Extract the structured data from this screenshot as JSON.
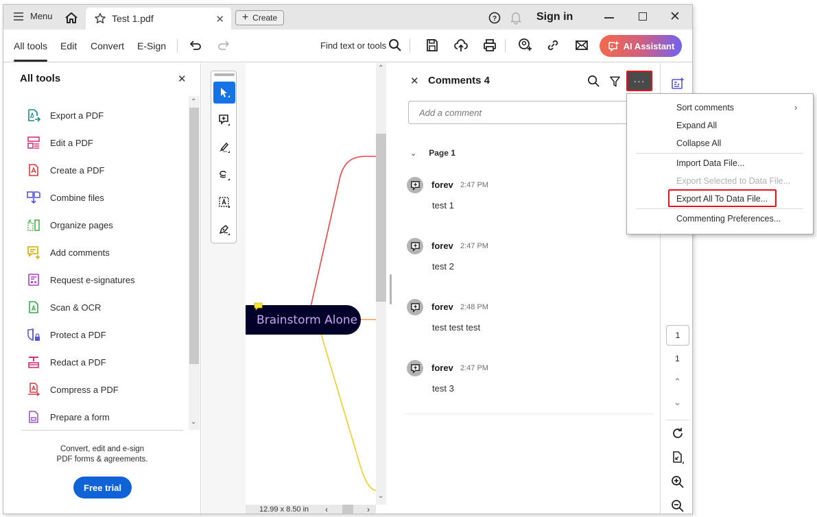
{
  "titlebar": {
    "menu_label": "Menu",
    "tab_title": "Test 1.pdf",
    "create_label": "Create",
    "sign_in_label": "Sign in"
  },
  "toolbar": {
    "tabs": [
      {
        "label": "All tools",
        "active": true
      },
      {
        "label": "Edit",
        "active": false
      },
      {
        "label": "Convert",
        "active": false
      },
      {
        "label": "E-Sign",
        "active": false
      }
    ],
    "find_label": "Find text or tools",
    "ai_assistant_label": "AI Assistant"
  },
  "left_panel": {
    "title": "All tools",
    "items": [
      {
        "label": "Export a PDF",
        "icon": "export-pdf-icon",
        "color": "#1a8a8a"
      },
      {
        "label": "Edit a PDF",
        "icon": "edit-pdf-icon",
        "color": "#d5317a"
      },
      {
        "label": "Create a PDF",
        "icon": "create-pdf-icon",
        "color": "#d7373f"
      },
      {
        "label": "Combine files",
        "icon": "combine-files-icon",
        "color": "#5a55d6"
      },
      {
        "label": "Organize pages",
        "icon": "organize-pages-icon",
        "color": "#4caf50"
      },
      {
        "label": "Add comments",
        "icon": "add-comments-icon",
        "color": "#d4a900"
      },
      {
        "label": "Request e-signatures",
        "icon": "request-esign-icon",
        "color": "#b03bc9"
      },
      {
        "label": "Scan & OCR",
        "icon": "scan-ocr-icon",
        "color": "#3aa655"
      },
      {
        "label": "Protect a PDF",
        "icon": "protect-pdf-icon",
        "color": "#5a55d6"
      },
      {
        "label": "Redact a PDF",
        "icon": "redact-pdf-icon",
        "color": "#d5317a"
      },
      {
        "label": "Compress a PDF",
        "icon": "compress-pdf-icon",
        "color": "#d7373f"
      },
      {
        "label": "Prepare a form",
        "icon": "prepare-form-icon",
        "color": "#9b51c9"
      }
    ],
    "promo_line1": "Convert, edit and e-sign",
    "promo_line2": "PDF forms & agreements.",
    "free_trial_label": "Free trial"
  },
  "document": {
    "node_label": "Brainstorm Alone",
    "page_size": "12.99 x 8.50 in"
  },
  "comments": {
    "title": "Comments 4",
    "input_placeholder": "Add a comment",
    "page_group": "Page 1",
    "items": [
      {
        "author": "forev",
        "time": "2:47 PM",
        "text": "test 1"
      },
      {
        "author": "forev",
        "time": "2:47 PM",
        "text": "test 2"
      },
      {
        "author": "forev",
        "time": "2:48 PM",
        "text": "test test test"
      },
      {
        "author": "forev",
        "time": "2:47 PM",
        "text": "test 3"
      }
    ]
  },
  "more_menu": {
    "items": [
      {
        "label": "Sort comments",
        "has_submenu": true,
        "disabled": false
      },
      {
        "label": "Expand All",
        "disabled": false
      },
      {
        "label": "Collapse All",
        "disabled": false
      },
      {
        "label": "Import Data File...",
        "disabled": false
      },
      {
        "label": "Export Selected to Data File...",
        "disabled": true
      },
      {
        "label": "Export All To Data File...",
        "disabled": false,
        "highlighted": true
      },
      {
        "label": "Commenting Preferences...",
        "disabled": false
      }
    ]
  },
  "page_nav": {
    "current_page": "1",
    "total_pages": "1"
  },
  "colors": {
    "accent_blue": "#1473e6",
    "highlight_red": "#e8121f",
    "free_trial_blue": "#0f63d6",
    "node_bg": "#03002a",
    "node_text": "#c7a6f0"
  }
}
